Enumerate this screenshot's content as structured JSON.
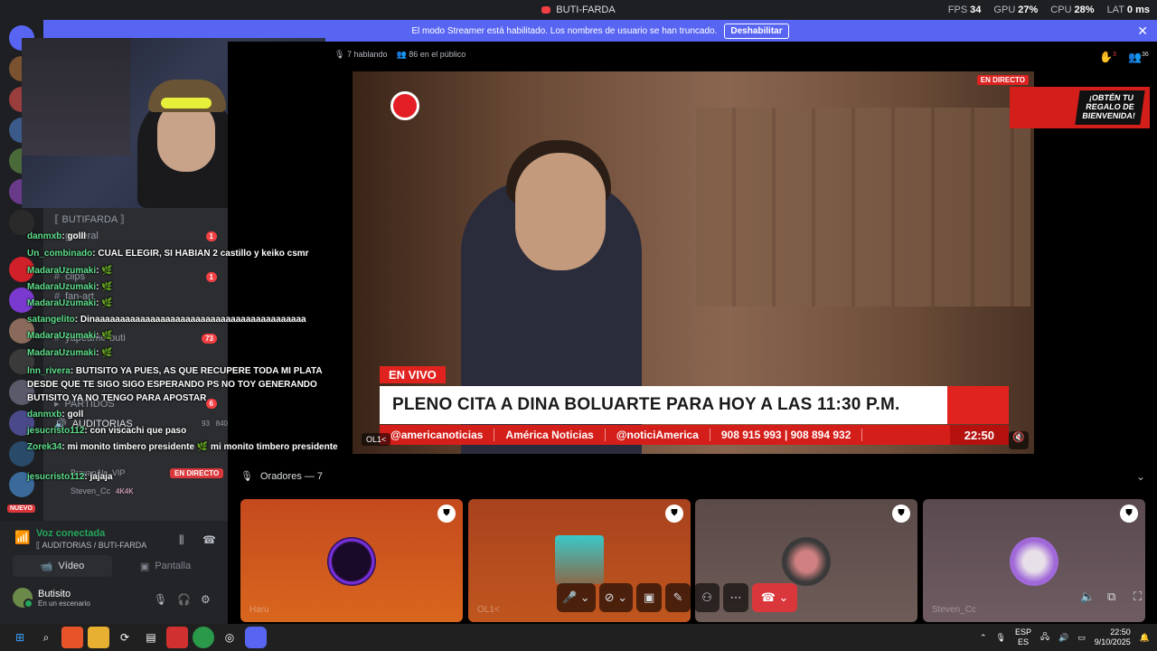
{
  "window": {
    "title": "BUTI-FARDA",
    "stats": [
      {
        "label": "FPS",
        "value": "34"
      },
      {
        "label": "GPU",
        "value": "27%"
      },
      {
        "label": "CPU",
        "value": "28%"
      },
      {
        "label": "LAT",
        "value": "0 ms"
      }
    ]
  },
  "banner": {
    "text": "El modo Streamer está habilitado. Los nombres de usuario se han truncado.",
    "button": "Deshabilitar"
  },
  "sidebar": {
    "category": "⟦ BUTIFARDA ⟧",
    "channels": [
      {
        "name": "general",
        "badge": "1"
      },
      {
        "name": "clips",
        "badge": "1"
      },
      {
        "name": "fan-art",
        "badge": ""
      },
      {
        "name": "yapeame-buti",
        "badge": "73"
      },
      {
        "name": "PARTIDOS",
        "badge": "6"
      },
      {
        "name": "AUDITORIAS",
        "badge": ""
      }
    ],
    "voice_members": [
      {
        "name": "BrayanAlc_VIP",
        "tag": ""
      },
      {
        "name": "Steven_Cc",
        "tag": "4K4K"
      }
    ],
    "live_badge": "EN DIRECTO",
    "new_badge": "NUEVO",
    "auditorias_counts": {
      "viewers": "93",
      "listeners": "840"
    }
  },
  "chat": [
    {
      "user": "danmxb",
      "msg": ": golll"
    },
    {
      "user": "Un_combinado",
      "msg": ": CUAL ELEGIR, SI HABIAN 2 castillo y keiko csmr"
    },
    {
      "user": "MadaraUzumaki",
      "msg": ": 🌿"
    },
    {
      "user": "MadaraUzumaki",
      "msg": ": 🌿"
    },
    {
      "user": "MadaraUzumaki",
      "msg": ": 🌿"
    },
    {
      "user": "satangelito",
      "msg": ": Dinaaaaaaaaaaaaaaaaaaaaaaaaaaaaaaaaaaaaaaaaaa"
    },
    {
      "user": "MadaraUzumaki",
      "msg": ": 🌿"
    },
    {
      "user": "MadaraUzumaki",
      "msg": ": 🌿"
    },
    {
      "user": "lnn_rivera",
      "msg": ": BUTISITO YA PUES, AS QUE RECUPERE TODA MI PLATA DESDE QUE TE SIGO SIGO ESPERANDO PS NO TOY GENERANDO BUTISITO YA NO TENGO PARA APOSTAR"
    },
    {
      "user": "danmxb",
      "msg": ": goll"
    },
    {
      "user": "jesucristo112",
      "msg": ": con viscachi que paso"
    },
    {
      "user": "Zorek34",
      "msg": ": mi monito timbero presidente 🌿 mi monito timbero presidente"
    },
    {
      "user": "jesucristo112",
      "msg": ": jajaja"
    }
  ],
  "voice": {
    "status": "Voz conectada",
    "channel": "⟦ AUDITORIAS / BUTI-FARDA",
    "video": "Vídeo",
    "screen": "Pantalla"
  },
  "user": {
    "name": "Butisito",
    "status": "En un escenario"
  },
  "stage": {
    "speaking": "7 hablando",
    "audience": "86 en el público",
    "hand_count": "3",
    "people_count": "36"
  },
  "stream": {
    "live_label": "EN DIRECTO",
    "en_vivo": "EN VIVO",
    "headline": "PLENO CITA A DINA BOLUARTE PARA HOY A LAS 11:30 P.M.",
    "ticker": [
      "@americanoticias",
      "América Noticias",
      "@noticiAmerica",
      "908 915 993  |  908 894 932"
    ],
    "time": "22:50",
    "streamer_tag": "OL1<"
  },
  "promo": {
    "text": "¡OBTÉN TU REGALO DE BIENVENIDA!"
  },
  "speakers": {
    "label": "Oradores — 7",
    "tiles": [
      "Haru",
      "OL1<",
      "",
      "Steven_Cc"
    ]
  },
  "taskbar": {
    "lang": "ESP",
    "lang2": "ES",
    "time": "22:50",
    "date": "9/10/2025"
  },
  "colors": {
    "accent": "#5865f2",
    "danger": "#da373c",
    "online": "#23a55a"
  }
}
